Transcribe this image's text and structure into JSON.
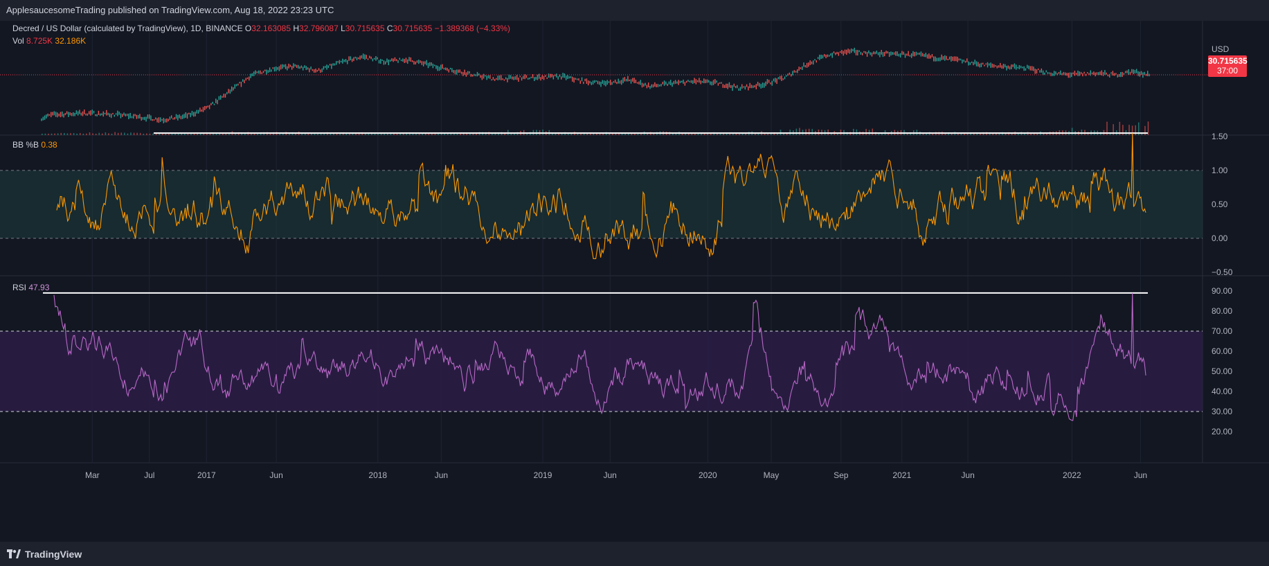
{
  "header": {
    "published": "ApplesaucesomeTrading published on TradingView.com, Aug 18, 2022 23:23 UTC"
  },
  "price_pane": {
    "symbol": "Decred / US Dollar (calculated by TradingView), 1D, BINANCE",
    "o_label": "O",
    "o_value": "32.163085",
    "h_label": "H",
    "h_value": "32.796087",
    "l_label": "L",
    "l_value": "30.715635",
    "c_label": "C",
    "c_value": "30.715635",
    "change": "−1.389368 (−4.33%)",
    "vol_label": "Vol",
    "vol_value1": "8.725K",
    "vol_value2": "32.186K",
    "currency": "USD",
    "last_price": "30.715635",
    "countdown": "37:00"
  },
  "bb_pane": {
    "label": "BB %B",
    "value": "0.38"
  },
  "rsi_pane": {
    "label": "RSI",
    "value": "47.93"
  },
  "footer": {
    "brand": "TradingView"
  },
  "colors": {
    "background": "#131722",
    "grid": "#1f2433",
    "up": "#26a69a",
    "down": "#ef5350",
    "bb_line": "#ff9800",
    "bb_band_fill": "#1b3d3d",
    "rsi_line": "#ba68c8",
    "rsi_band_fill": "#2a1d44",
    "level_line": "#ffffff",
    "last_price": "#f23645"
  },
  "chart_data": [
    {
      "type": "line",
      "name": "price",
      "x_labels": [
        "Mar",
        "Jul",
        "2017",
        "Jun",
        "2018",
        "Jun",
        "2019",
        "Jun",
        "2020",
        "May",
        "Sep",
        "2021",
        "Jun",
        "2022",
        "Jun"
      ],
      "x_label_fraction": [
        0.04,
        0.085,
        0.13,
        0.185,
        0.265,
        0.315,
        0.395,
        0.448,
        0.525,
        0.575,
        0.63,
        0.678,
        0.73,
        0.812,
        0.866
      ],
      "points": [
        [
          0.0,
          8
        ],
        [
          0.01,
          12
        ],
        [
          0.04,
          14
        ],
        [
          0.07,
          12
        ],
        [
          0.09,
          9
        ],
        [
          0.11,
          6
        ],
        [
          0.13,
          10
        ],
        [
          0.15,
          20
        ],
        [
          0.17,
          40
        ],
        [
          0.19,
          60
        ],
        [
          0.21,
          68
        ],
        [
          0.23,
          70
        ],
        [
          0.25,
          65
        ],
        [
          0.27,
          75
        ],
        [
          0.29,
          82
        ],
        [
          0.31,
          76
        ],
        [
          0.33,
          78
        ],
        [
          0.35,
          72
        ],
        [
          0.37,
          66
        ],
        [
          0.39,
          60
        ],
        [
          0.41,
          55
        ],
        [
          0.43,
          56
        ],
        [
          0.45,
          57
        ],
        [
          0.47,
          58
        ],
        [
          0.49,
          52
        ],
        [
          0.51,
          50
        ],
        [
          0.53,
          54
        ],
        [
          0.55,
          46
        ],
        [
          0.57,
          50
        ],
        [
          0.59,
          52
        ],
        [
          0.61,
          50
        ],
        [
          0.63,
          44
        ],
        [
          0.65,
          48
        ],
        [
          0.67,
          56
        ],
        [
          0.69,
          72
        ],
        [
          0.71,
          84
        ],
        [
          0.73,
          88
        ],
        [
          0.75,
          86
        ],
        [
          0.77,
          85
        ],
        [
          0.79,
          84
        ],
        [
          0.81,
          80
        ],
        [
          0.83,
          77
        ],
        [
          0.85,
          72
        ],
        [
          0.87,
          70
        ],
        [
          0.89,
          68
        ],
        [
          0.91,
          62
        ],
        [
          0.93,
          60
        ],
        [
          0.95,
          62
        ],
        [
          0.97,
          60
        ],
        [
          0.985,
          64
        ],
        [
          1.0,
          60
        ]
      ],
      "last_value": 30.715635,
      "volume_levels": [
        0.04,
        0.08,
        0.05,
        0.06,
        0.12,
        0.1,
        0.08,
        0.07,
        0.06,
        0.09,
        0.2,
        0.1,
        0.08,
        0.15,
        0.1,
        0.12,
        0.3,
        0.25,
        0.2,
        0.1,
        0.08,
        0.12,
        0.3,
        0.6
      ]
    },
    {
      "type": "line",
      "name": "BB %B",
      "y_ticks": [
        1.5,
        1.0,
        0.5,
        0.0,
        -0.5
      ],
      "band": [
        0.0,
        1.0
      ],
      "max_line": 1.55,
      "last_value": 0.38
    },
    {
      "type": "line",
      "name": "RSI",
      "y_ticks": [
        90,
        80,
        70,
        60,
        50,
        40,
        30,
        20
      ],
      "band": [
        30,
        70
      ],
      "max_line": 89,
      "last_value": 47.93
    }
  ]
}
